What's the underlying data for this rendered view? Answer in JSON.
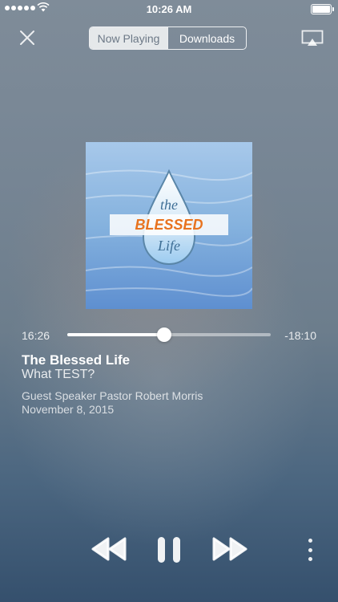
{
  "status_bar": {
    "time": "10:26 AM"
  },
  "header": {
    "close_icon": "close-icon",
    "tabs": [
      {
        "label": "Now Playing",
        "selected": true
      },
      {
        "label": "Downloads",
        "selected": false
      }
    ],
    "airplay_icon": "airplay-icon"
  },
  "artwork": {
    "line1": "the",
    "line2": "BLESSED",
    "line3": "Life",
    "accent_color": "#e8731f",
    "background_color": "#8ab8e0"
  },
  "player": {
    "elapsed": "16:26",
    "remaining": "-18:10",
    "progress": 0.475
  },
  "track": {
    "title": "The Blessed Life",
    "subtitle": "What TEST?",
    "speaker": "Guest Speaker Pastor Robert Morris",
    "date": "November 8, 2015"
  },
  "controls": {
    "rewind_icon": "rewind-icon",
    "pause_icon": "pause-icon",
    "forward_icon": "fast-forward-icon",
    "more_icon": "more-vertical-icon"
  }
}
